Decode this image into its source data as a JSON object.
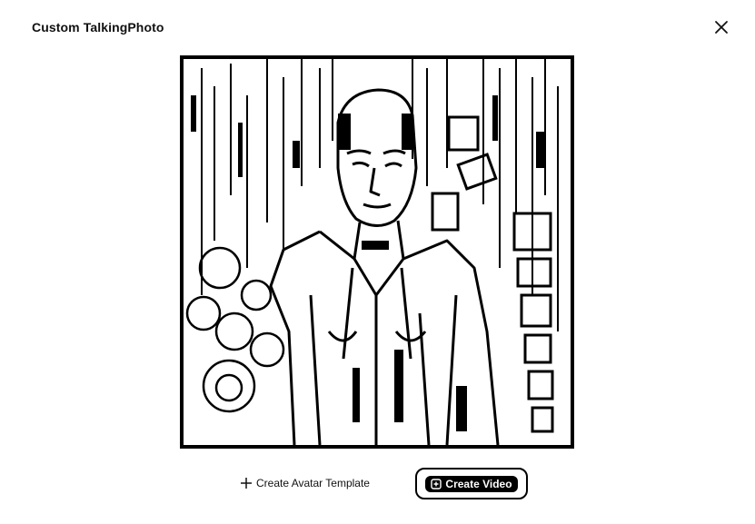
{
  "modal": {
    "title": "Custom TalkingPhoto"
  },
  "icons": {
    "close": "close-icon",
    "plus": "plus-icon",
    "video": "video-icon"
  },
  "actions": {
    "create_avatar_template_label": "Create Avatar Template",
    "create_video_label": "Create Video"
  },
  "colors": {
    "primary": "#000000",
    "background": "#ffffff"
  }
}
